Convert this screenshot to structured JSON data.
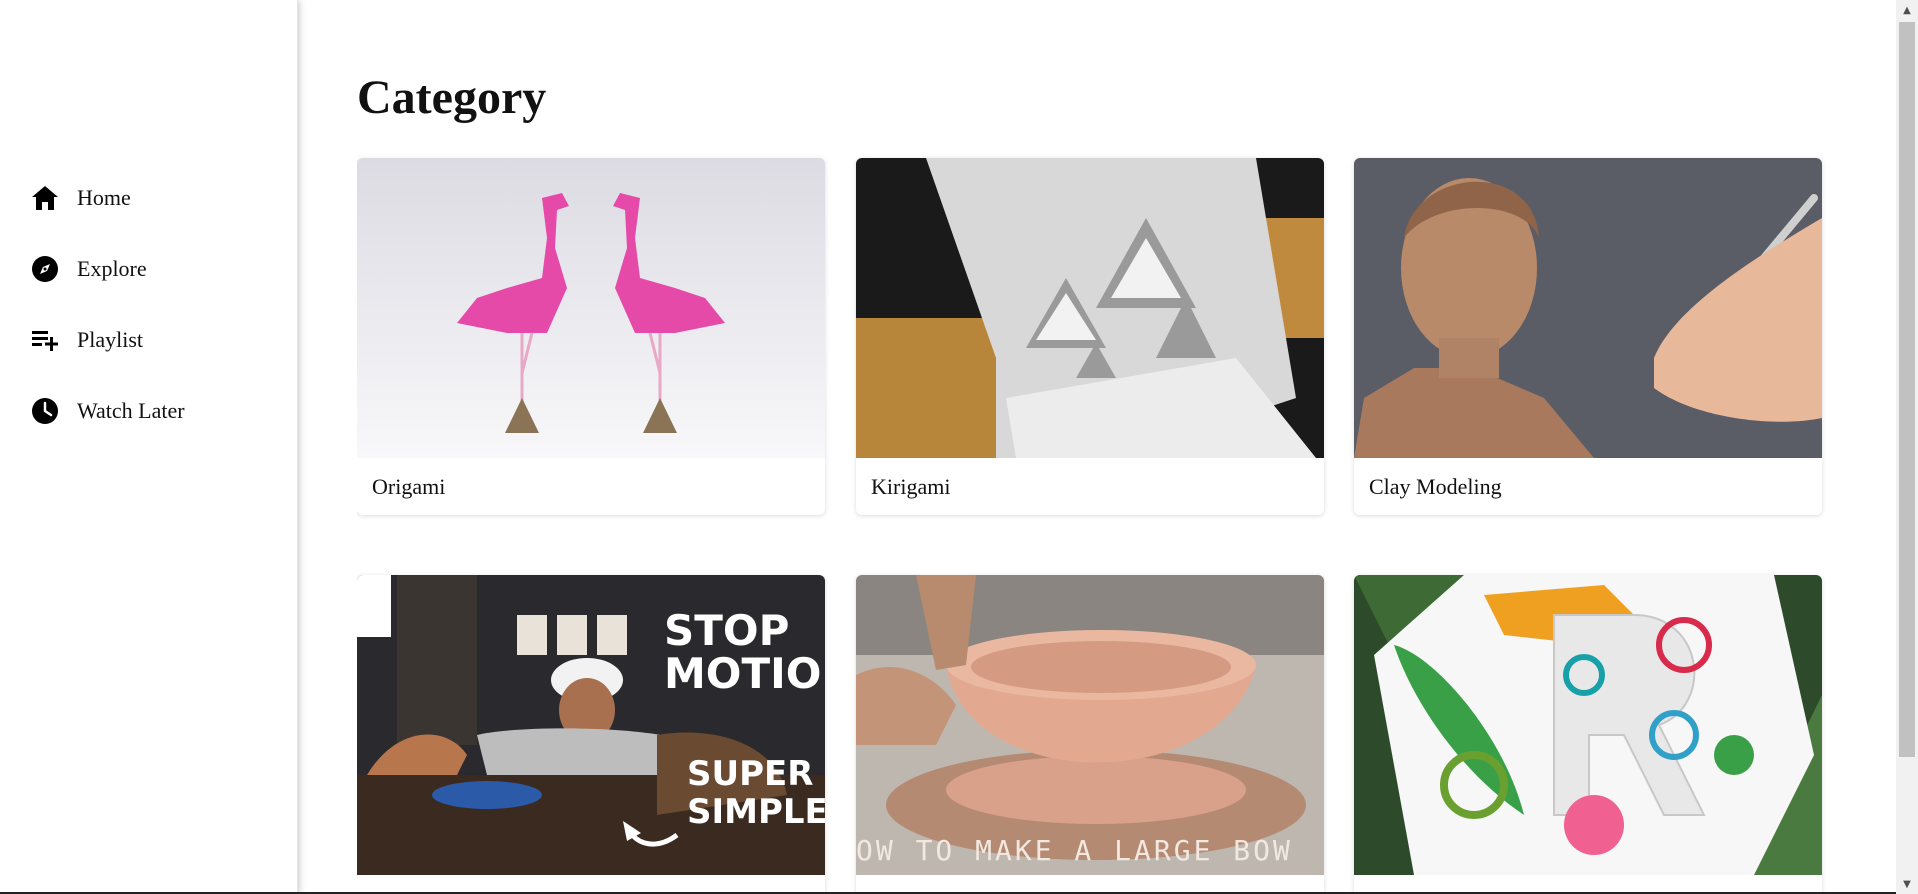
{
  "sidebar": {
    "items": [
      {
        "label": "Home",
        "icon": "home-icon"
      },
      {
        "label": "Explore",
        "icon": "compass-icon"
      },
      {
        "label": "Playlist",
        "icon": "playlist-add-icon"
      },
      {
        "label": "Watch Later",
        "icon": "clock-icon"
      }
    ]
  },
  "main": {
    "title": "Category",
    "categories": [
      {
        "label": "Origami"
      },
      {
        "label": "Kirigami"
      },
      {
        "label": "Clay Modeling"
      },
      {
        "label": "",
        "thumb_text": [
          "STOP",
          "MOTION",
          "SUPER",
          "SIMPLE"
        ]
      },
      {
        "label": "",
        "thumb_text": [
          "OW TO MAKE A LARGE BOW"
        ]
      },
      {
        "label": ""
      }
    ]
  }
}
